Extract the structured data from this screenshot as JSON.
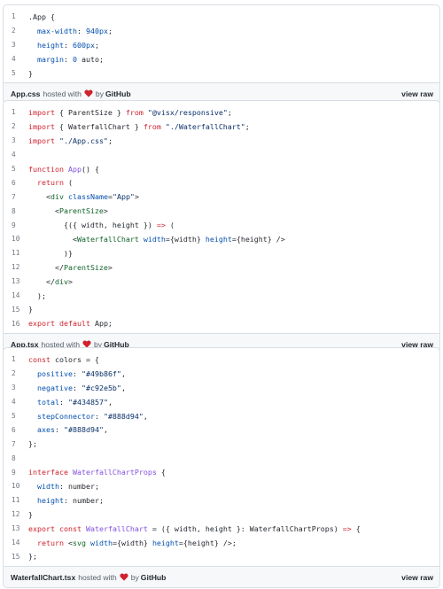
{
  "accent_heart": "#cf222e",
  "gists": [
    {
      "file": "App.css",
      "hosted_with": "hosted with",
      "by": "by",
      "github": "GitHub",
      "view_raw": "view raw",
      "lines": [
        [
          [
            "pl",
            ".App {"
          ]
        ],
        [
          [
            "pl",
            "  "
          ],
          [
            "attr",
            "max-width"
          ],
          [
            "pl",
            ": "
          ],
          [
            "attr",
            "940px"
          ],
          [
            "pl",
            ";"
          ]
        ],
        [
          [
            "pl",
            "  "
          ],
          [
            "attr",
            "height"
          ],
          [
            "pl",
            ": "
          ],
          [
            "attr",
            "600px"
          ],
          [
            "pl",
            ";"
          ]
        ],
        [
          [
            "pl",
            "  "
          ],
          [
            "attr",
            "margin"
          ],
          [
            "pl",
            ": "
          ],
          [
            "attr",
            "0"
          ],
          [
            "pl",
            " auto;"
          ]
        ],
        [
          [
            "pl",
            "}"
          ]
        ]
      ]
    },
    {
      "file": "App.tsx",
      "hosted_with": "hosted with",
      "by": "by",
      "github": "GitHub",
      "view_raw": "view raw",
      "lines": [
        [
          [
            "kw",
            "import"
          ],
          [
            "pl",
            " { ParentSize } "
          ],
          [
            "kw",
            "from"
          ],
          [
            "pl",
            " "
          ],
          [
            "str",
            "\"@visx/responsive\""
          ],
          [
            "pl",
            ";"
          ]
        ],
        [
          [
            "kw",
            "import"
          ],
          [
            "pl",
            " { WaterfallChart } "
          ],
          [
            "kw",
            "from"
          ],
          [
            "pl",
            " "
          ],
          [
            "str",
            "\"./WaterfallChart\""
          ],
          [
            "pl",
            ";"
          ]
        ],
        [
          [
            "kw",
            "import"
          ],
          [
            "pl",
            " "
          ],
          [
            "str",
            "\"./App.css\""
          ],
          [
            "pl",
            ";"
          ]
        ],
        [
          [
            "pl",
            ""
          ]
        ],
        [
          [
            "kw",
            "function"
          ],
          [
            "pl",
            " "
          ],
          [
            "fn",
            "App"
          ],
          [
            "pl",
            "() {"
          ]
        ],
        [
          [
            "pl",
            "  "
          ],
          [
            "kw",
            "return"
          ],
          [
            "pl",
            " ("
          ]
        ],
        [
          [
            "pl",
            "    <"
          ],
          [
            "tag",
            "div"
          ],
          [
            "pl",
            " "
          ],
          [
            "attr",
            "className"
          ],
          [
            "pl",
            "="
          ],
          [
            "str",
            "\"App\""
          ],
          [
            "pl",
            ">"
          ]
        ],
        [
          [
            "pl",
            "      <"
          ],
          [
            "tag",
            "ParentSize"
          ],
          [
            "pl",
            ">"
          ]
        ],
        [
          [
            "pl",
            "        {({ width, height }) "
          ],
          [
            "kw",
            "=>"
          ],
          [
            "pl",
            " ("
          ]
        ],
        [
          [
            "pl",
            "          <"
          ],
          [
            "tag",
            "WaterfallChart"
          ],
          [
            "pl",
            " "
          ],
          [
            "attr",
            "width"
          ],
          [
            "pl",
            "={width} "
          ],
          [
            "attr",
            "height"
          ],
          [
            "pl",
            "={height} />"
          ]
        ],
        [
          [
            "pl",
            "        )}"
          ]
        ],
        [
          [
            "pl",
            "      </"
          ],
          [
            "tag",
            "ParentSize"
          ],
          [
            "pl",
            ">"
          ]
        ],
        [
          [
            "pl",
            "    </"
          ],
          [
            "tag",
            "div"
          ],
          [
            "pl",
            ">"
          ]
        ],
        [
          [
            "pl",
            "  );"
          ]
        ],
        [
          [
            "pl",
            "}"
          ]
        ],
        [
          [
            "kw",
            "export"
          ],
          [
            "pl",
            " "
          ],
          [
            "kw",
            "default"
          ],
          [
            "pl",
            " App;"
          ]
        ]
      ]
    },
    {
      "file": "WaterfallChart.tsx",
      "hosted_with": "hosted with",
      "by": "by",
      "github": "GitHub",
      "view_raw": "view raw",
      "lines": [
        [
          [
            "kw",
            "const"
          ],
          [
            "pl",
            " colors = {"
          ]
        ],
        [
          [
            "pl",
            "  "
          ],
          [
            "attr",
            "positive"
          ],
          [
            "pl",
            ": "
          ],
          [
            "str",
            "\"#49b86f\""
          ],
          [
            "pl",
            ","
          ]
        ],
        [
          [
            "pl",
            "  "
          ],
          [
            "attr",
            "negative"
          ],
          [
            "pl",
            ": "
          ],
          [
            "str",
            "\"#c92e5b\""
          ],
          [
            "pl",
            ","
          ]
        ],
        [
          [
            "pl",
            "  "
          ],
          [
            "attr",
            "total"
          ],
          [
            "pl",
            ": "
          ],
          [
            "str",
            "\"#434857\""
          ],
          [
            "pl",
            ","
          ]
        ],
        [
          [
            "pl",
            "  "
          ],
          [
            "attr",
            "stepConnector"
          ],
          [
            "pl",
            ": "
          ],
          [
            "str",
            "\"#888d94\""
          ],
          [
            "pl",
            ","
          ]
        ],
        [
          [
            "pl",
            "  "
          ],
          [
            "attr",
            "axes"
          ],
          [
            "pl",
            ": "
          ],
          [
            "str",
            "\"#888d94\""
          ],
          [
            "pl",
            ","
          ]
        ],
        [
          [
            "pl",
            "};"
          ]
        ],
        [
          [
            "pl",
            ""
          ]
        ],
        [
          [
            "kw",
            "interface"
          ],
          [
            "pl",
            " "
          ],
          [
            "fn",
            "WaterfallChartProps"
          ],
          [
            "pl",
            " {"
          ]
        ],
        [
          [
            "pl",
            "  "
          ],
          [
            "attr",
            "width"
          ],
          [
            "pl",
            ": number;"
          ]
        ],
        [
          [
            "pl",
            "  "
          ],
          [
            "attr",
            "height"
          ],
          [
            "pl",
            ": number;"
          ]
        ],
        [
          [
            "pl",
            "}"
          ]
        ],
        [
          [
            "kw",
            "export"
          ],
          [
            "pl",
            " "
          ],
          [
            "kw",
            "const"
          ],
          [
            "pl",
            " "
          ],
          [
            "fn",
            "WaterfallChart"
          ],
          [
            "pl",
            " = ({ width, height }: WaterfallChartProps) "
          ],
          [
            "kw",
            "=>"
          ],
          [
            "pl",
            " {"
          ]
        ],
        [
          [
            "pl",
            "  "
          ],
          [
            "kw",
            "return"
          ],
          [
            "pl",
            " <"
          ],
          [
            "tag",
            "svg"
          ],
          [
            "pl",
            " "
          ],
          [
            "attr",
            "width"
          ],
          [
            "pl",
            "={width} "
          ],
          [
            "attr",
            "height"
          ],
          [
            "pl",
            "={height} />;"
          ]
        ],
        [
          [
            "pl",
            "};"
          ]
        ]
      ]
    }
  ]
}
